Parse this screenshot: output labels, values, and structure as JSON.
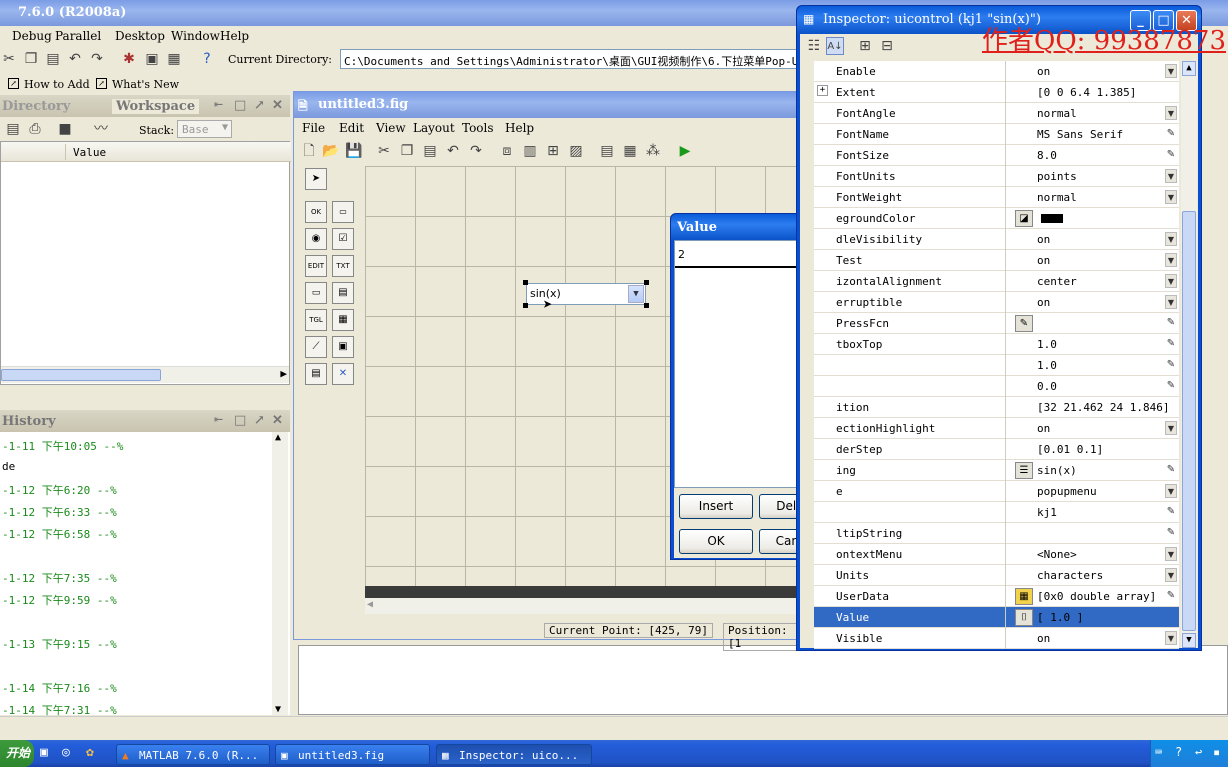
{
  "matlab": {
    "title": "7.6.0 (R2008a)",
    "menus": [
      "Debug",
      "Parallel",
      "Desktop",
      "Window",
      "Help"
    ],
    "current_dir_label": "Current Directory:",
    "current_dir_value": "C:\\Documents and Settings\\Administrator\\桌面\\GUI视频制作\\6.下拉菜单Pop-Up Me",
    "shortcuts": [
      "How to Add",
      "What's New"
    ]
  },
  "left_panel": {
    "tab_directory": "Directory",
    "tab_workspace": "Workspace",
    "stack_label": "Stack:",
    "stack_value": "Base",
    "col_value": "Value"
  },
  "history": {
    "title": "History",
    "lines": [
      {
        "text": "-1-11  下午10:05 --%",
        "green": true
      },
      {
        "text": "de",
        "green": false
      },
      {
        "text": "-1-12 下午6:20 --%",
        "green": true
      },
      {
        "text": "-1-12 下午6:33 --%",
        "green": true
      },
      {
        "text": "-1-12 下午6:58 --%",
        "green": true
      },
      {
        "text": "",
        "green": false
      },
      {
        "text": "-1-12 下午7:35 --%",
        "green": true
      },
      {
        "text": "-1-12 下午9:59 --%",
        "green": true
      },
      {
        "text": "",
        "green": false
      },
      {
        "text": "-1-13 下午9:15 --%",
        "green": true
      },
      {
        "text": "",
        "green": false
      },
      {
        "text": "-1-14 下午7:16 --%",
        "green": true
      },
      {
        "text": "-1-14 下午7:31 --%",
        "green": true
      }
    ]
  },
  "guide": {
    "title": "untitled3.fig",
    "menus": [
      "File",
      "Edit",
      "View",
      "Layout",
      "Tools",
      "Help"
    ],
    "popup_text": "sin(x)",
    "status_current_point": "Current Point:  [425, 79]",
    "status_position": "Position: [1"
  },
  "value_dialog": {
    "title": "Value",
    "value": "2",
    "insert_label": "Insert",
    "delete_label": "Delete",
    "ok_label": "OK",
    "cancel_label": "Cancel"
  },
  "inspector": {
    "title": "Inspector:  uicontrol (kj1 \"sin(x)\")",
    "watermark": "作者QQ: 99387873",
    "rows": [
      {
        "name": "Enable",
        "value": "on",
        "ctl": "dd"
      },
      {
        "name": "Extent",
        "value": "[0 0 6.4 1.385]",
        "ctl": "",
        "expand": true
      },
      {
        "name": "FontAngle",
        "value": "normal",
        "ctl": "dd"
      },
      {
        "name": "FontName",
        "value": "MS Sans Serif",
        "ctl": "pencil"
      },
      {
        "name": "FontSize",
        "value": "8.0",
        "ctl": "pencil"
      },
      {
        "name": "FontUnits",
        "value": "points",
        "ctl": "dd"
      },
      {
        "name": "FontWeight",
        "value": "normal",
        "ctl": "dd"
      },
      {
        "name": "egroundColor",
        "value": "",
        "ctl": "",
        "btn": "color",
        "swatch": "#000000"
      },
      {
        "name": "dleVisibility",
        "value": "on",
        "ctl": "dd"
      },
      {
        "name": "Test",
        "value": "on",
        "ctl": "dd"
      },
      {
        "name": "izontalAlignment",
        "value": "center",
        "ctl": "dd"
      },
      {
        "name": "erruptible",
        "value": "on",
        "ctl": "dd"
      },
      {
        "name": "PressFcn",
        "value": "",
        "ctl": "pencil",
        "btn": "fcn"
      },
      {
        "name": "tboxTop",
        "value": "1.0",
        "ctl": "pencil"
      },
      {
        "name": "",
        "value": "1.0",
        "ctl": "pencil"
      },
      {
        "name": "",
        "value": "0.0",
        "ctl": "pencil"
      },
      {
        "name": "ition",
        "value": "[32 21.462 24 1.846]",
        "ctl": ""
      },
      {
        "name": "ectionHighlight",
        "value": "on",
        "ctl": "dd"
      },
      {
        "name": "derStep",
        "value": "[0.01 0.1]",
        "ctl": ""
      },
      {
        "name": "ing",
        "value": "sin(x)",
        "ctl": "pencil",
        "btn": "list"
      },
      {
        "name": "e",
        "value": "popupmenu",
        "ctl": "dd"
      },
      {
        "name": "",
        "value": "kj1",
        "ctl": "pencil"
      },
      {
        "name": "ltipString",
        "value": "",
        "ctl": "pencil"
      },
      {
        "name": "ontextMenu",
        "value": "<None>",
        "ctl": "dd"
      },
      {
        "name": "Units",
        "value": "characters",
        "ctl": "dd"
      },
      {
        "name": "UserData",
        "value": "[0x0  double array]",
        "ctl": "pencil",
        "btn": "grid"
      },
      {
        "name": "Value",
        "value": "[ 1.0 ]",
        "ctl": "",
        "btn": "array",
        "selected": true
      },
      {
        "name": "Visible",
        "value": "on",
        "ctl": "dd"
      }
    ]
  },
  "taskbar": {
    "start": "开始",
    "items": [
      "MATLAB  7.6.0 (R...",
      "untitled3.fig",
      "Inspector:  uico..."
    ]
  }
}
